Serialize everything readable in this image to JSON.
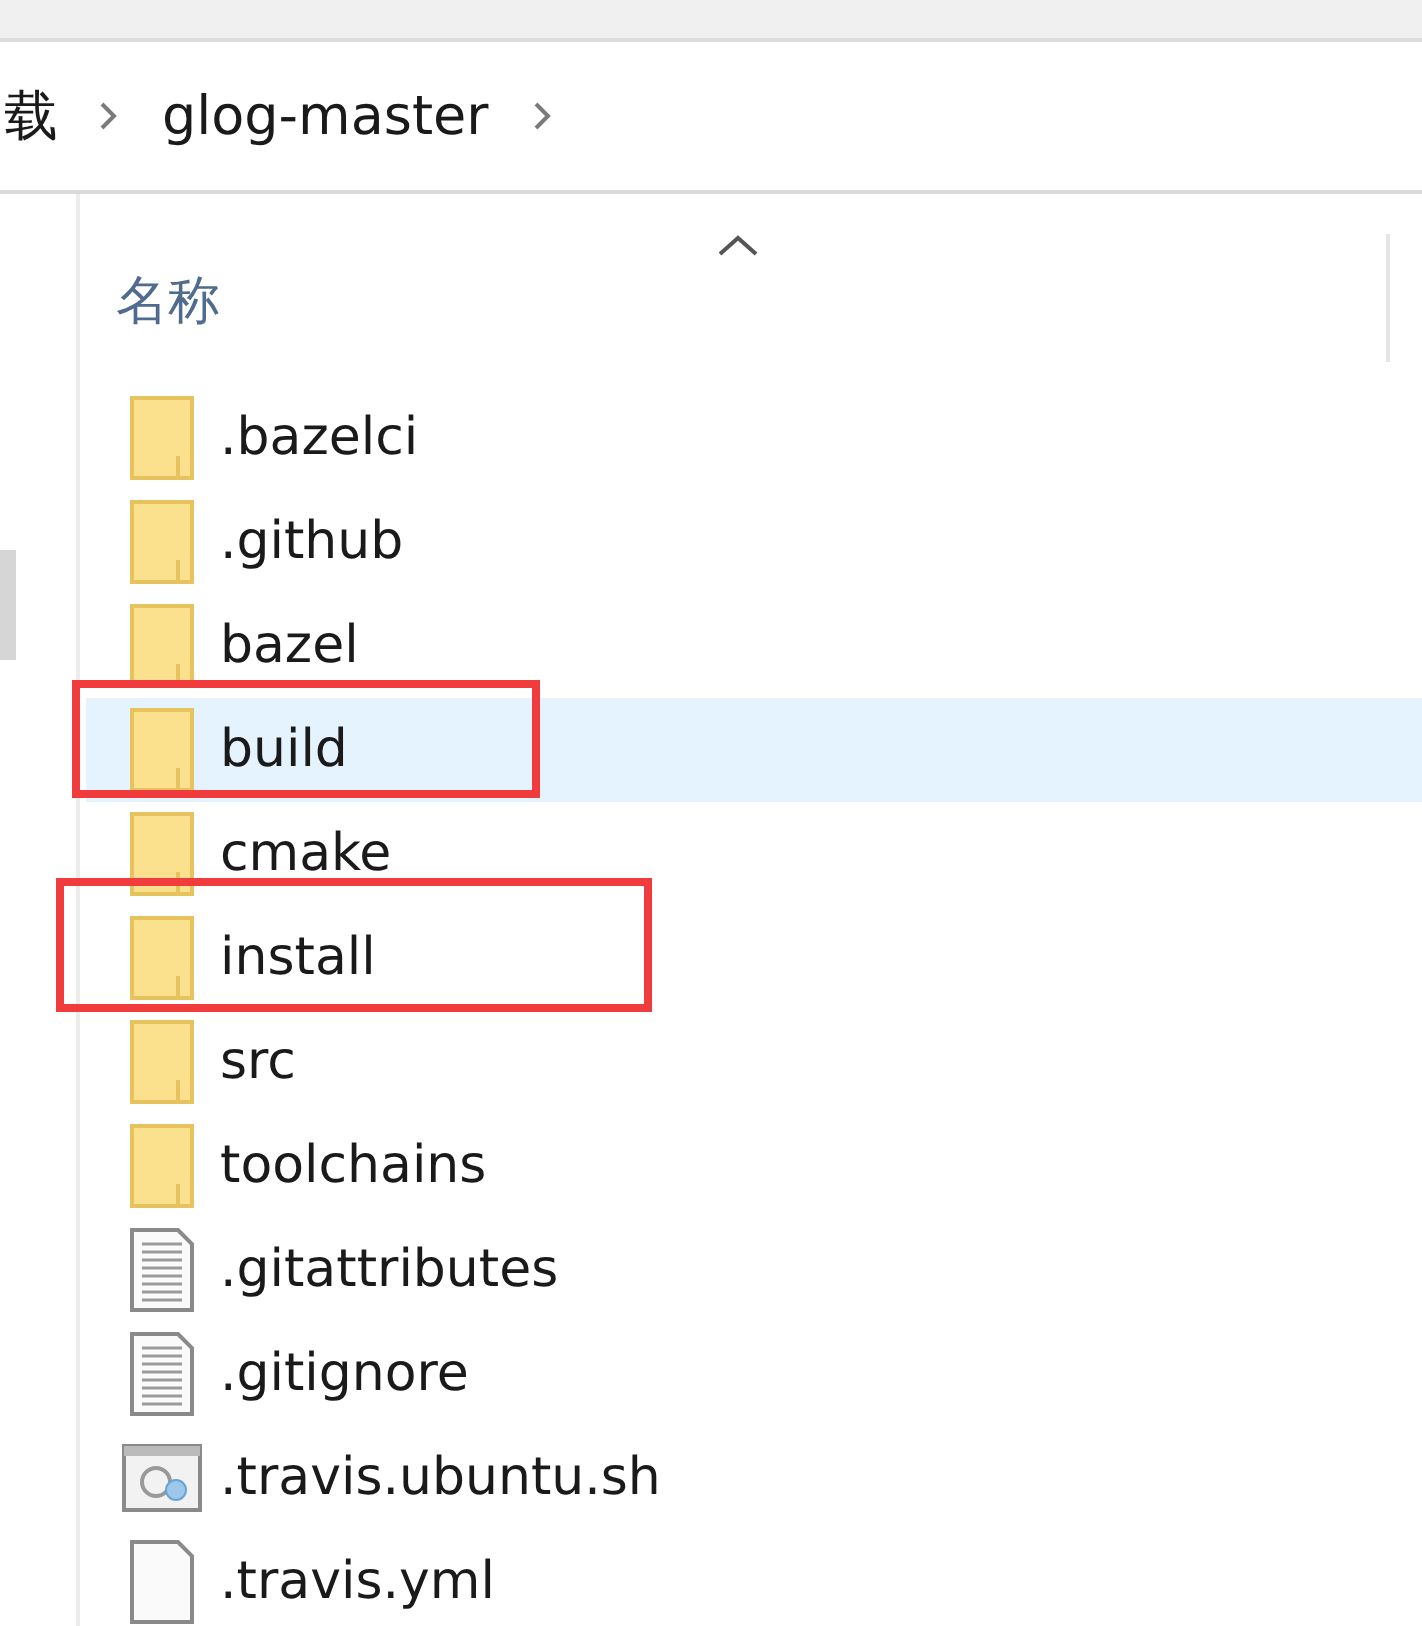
{
  "breadcrumb": [
    {
      "label": "载"
    },
    {
      "label": "glog-master"
    }
  ],
  "column_header": {
    "label": "名称"
  },
  "files": [
    {
      "name": ".bazelci",
      "kind": "folder",
      "selected": false,
      "annotated": false
    },
    {
      "name": ".github",
      "kind": "folder",
      "selected": false,
      "annotated": false
    },
    {
      "name": "bazel",
      "kind": "folder",
      "selected": false,
      "annotated": false
    },
    {
      "name": "build",
      "kind": "folder",
      "selected": true,
      "annotated": true
    },
    {
      "name": "cmake",
      "kind": "folder",
      "selected": false,
      "annotated": false
    },
    {
      "name": "install",
      "kind": "folder",
      "selected": false,
      "annotated": true
    },
    {
      "name": "src",
      "kind": "folder",
      "selected": false,
      "annotated": false
    },
    {
      "name": "toolchains",
      "kind": "folder",
      "selected": false,
      "annotated": false
    },
    {
      "name": ".gitattributes",
      "kind": "text",
      "selected": false,
      "annotated": false
    },
    {
      "name": ".gitignore",
      "kind": "text",
      "selected": false,
      "annotated": false
    },
    {
      "name": ".travis.ubuntu.sh",
      "kind": "script",
      "selected": false,
      "annotated": false
    },
    {
      "name": ".travis.yml",
      "kind": "file",
      "selected": false,
      "annotated": false
    }
  ]
}
